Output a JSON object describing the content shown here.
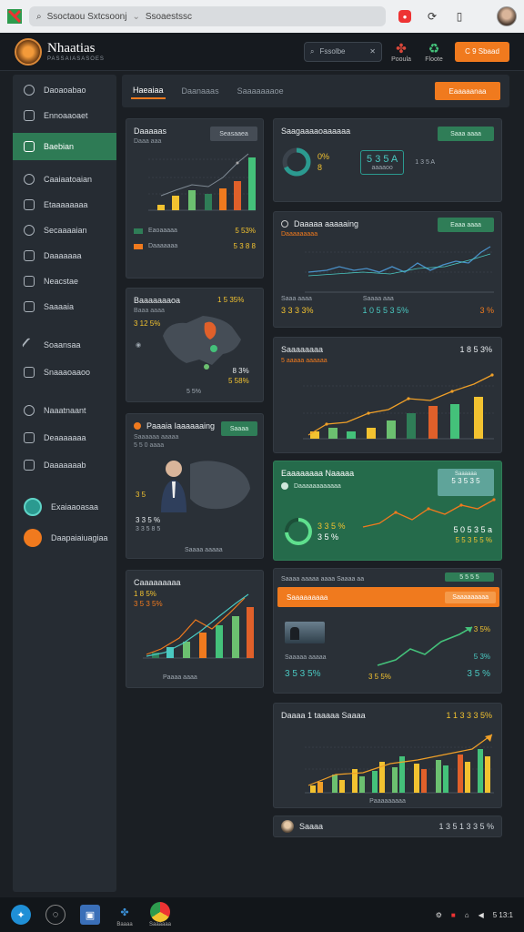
{
  "browser": {
    "address_left": "Ssoctaou Sxtcsoonj",
    "address_right": "Ssoaestssc"
  },
  "header": {
    "brand_title": "Nhaatias",
    "brand_subtitle": "PASSAIASASOES",
    "search_text": "Fssolbe",
    "icon1_label": "Pooula",
    "icon2_label": "Floote",
    "cta_label": "C 9 Sbaad"
  },
  "sidebar": {
    "items": [
      {
        "label": "Daoaoabao",
        "icon": "sprout-icon"
      },
      {
        "label": "Ennoaaoaet",
        "icon": "grid-icon"
      },
      {
        "label": "Baebian",
        "icon": "document-icon",
        "active": true
      },
      {
        "label": "Caaiaatoaian",
        "icon": "user-icon"
      },
      {
        "label": "Etaaaaaaaa",
        "icon": "check-icon"
      },
      {
        "label": "Secaaaaian",
        "icon": "gear-icon"
      },
      {
        "label": "Daaaaaaa",
        "icon": "folder-icon"
      },
      {
        "label": "Neacstae",
        "icon": "note-icon"
      },
      {
        "label": "Saaaaia",
        "icon": "file-icon"
      },
      {
        "label": "Soaansaa",
        "icon": "pen-icon"
      },
      {
        "label": "Snaaaoaaoo",
        "icon": "check-square-icon"
      },
      {
        "label": "Naaatnaant",
        "icon": "bulb-icon"
      },
      {
        "label": "Deaaaaaaa",
        "icon": "box-icon"
      },
      {
        "label": "Daaaaaaab",
        "icon": "mail-icon"
      },
      {
        "label": "Exaiaaoasaa",
        "icon": "teal-badge-icon"
      },
      {
        "label": "Daapaiaiuagiaa",
        "icon": "orange-badge-icon"
      }
    ]
  },
  "tabs": {
    "items": [
      "Haeaiaa",
      "Daanaaas",
      "Saaaaaaaoe"
    ],
    "button": "Eaaaaanaa"
  },
  "cards": {
    "c1": {
      "title": "Daaaaas",
      "sub": "Daaa aaa",
      "pill": "Seasaaea",
      "l1": "Eaoaaaaa",
      "v1": "5 53%",
      "l2": "Daaaaaaa",
      "v2": "5 3 8 8"
    },
    "c2": {
      "title": "Baaaaaaaoa",
      "sub": "Baaa aaaa",
      "v1": "3 12 5%",
      "v2": "8 3%",
      "v3": "5 58%",
      "v4": "5 5%",
      "pct": "1 5 35%"
    },
    "c3": {
      "title": "Paaaia Iaaaaaaing",
      "pill": "Saaaa",
      "sub": "Saaaaaa aaaaa",
      "sub2": "5 5 0 aaaa",
      "v1": "3 5",
      "v2": "3 3 5 %",
      "v3": "3 3 5 8 5",
      "foot": "Saaaa aaaaa"
    },
    "c4": {
      "title": "Caaaaaaaaa",
      "v1": "1 8 5%",
      "v2": "3 5 3 5%",
      "foot": "Paaaa aaaa"
    },
    "r1": {
      "title": "Saagaaaaoaaaaaa",
      "pill": "Saaa aaaa",
      "v1": "0%",
      "v2": "8",
      "v3": "5 3 5 A",
      "v4": "1 3 5 A",
      "sub": "aaaaoo"
    },
    "r2": {
      "title": "Daaaaa aaaaaing",
      "pill": "Eaaa aaaa",
      "sub": "Daaaaaaaaa",
      "foot1": "Saaa aaaa",
      "foot2": "Saaaa aaa",
      "v1": "3 3 3 3%",
      "v2": "1 0 5 5 3 5%",
      "v3": "3 %"
    },
    "r3": {
      "title": "Saaaaaaaa",
      "val": "1 8 5 3%",
      "legend": "5 aaaaa aaaaaa"
    },
    "r4": {
      "title": "Eaaaaaaaa Naaaaa",
      "sub": "Daaaaaaaaaaaa",
      "box": "5 3 5 3 5",
      "box_title": "Saaaaaa",
      "v1": "3 3 5 %",
      "v2": "3 5 %",
      "v3": "5 0 5 3 5 a",
      "v4": "5 5 3 5 5 %"
    },
    "r5": {
      "title": "Saaaa aaaaa aaaa Saaaa aa",
      "bar": "Saaaaaaaaa",
      "btn": "Saaaaaaaaa",
      "pill": "5 5 5 5",
      "v1": "3 5%",
      "v2": "5 3%",
      "v3": "3 5 3 5%",
      "v4": "3 5 5%",
      "v5": "3 5 %",
      "sub": "Saaaaa aaaaa"
    },
    "r6": {
      "title": "Daaaa 1 taaaaa Saaaa",
      "val": "1 1 3 3 3 5%",
      "foot": "Paaaaaaaaa"
    },
    "r7": {
      "title": "Saaaa",
      "val": "1 3 5 1 3 3 5 %"
    }
  },
  "taskbar": {
    "items": [
      "Baaaa",
      "Saaaaaa"
    ],
    "tray_time": "5 13:1"
  },
  "colors": {
    "orange": "#f07a1e",
    "green": "#2f7d57",
    "yellow": "#f2c230",
    "cyan": "#4ac9c2"
  }
}
